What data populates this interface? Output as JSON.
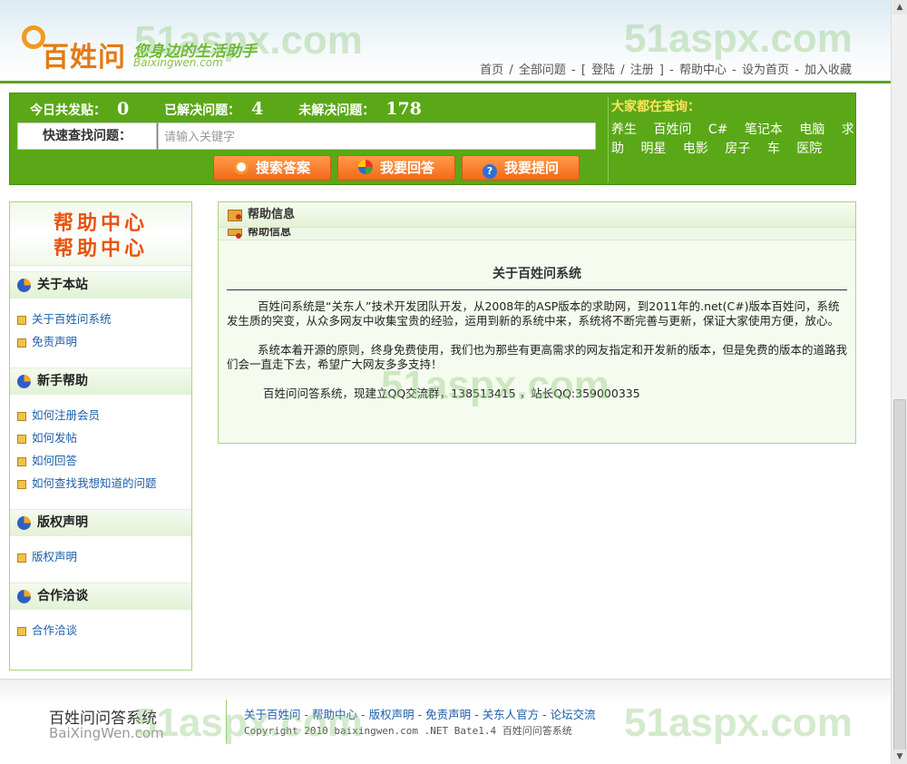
{
  "header": {
    "logo_text": "百姓问",
    "slogan": "您身边的生活助手",
    "slogan_sub": "Baixingwen.com",
    "nav": [
      "首页",
      "/",
      "全部问题",
      "-",
      "[",
      "登陆",
      "/",
      "注册",
      "]",
      "-",
      "帮助中心",
      "-",
      "设为首页",
      "-",
      "加入收藏"
    ]
  },
  "searchbar": {
    "today_label": "今日共发贴：",
    "today_value": "0",
    "solved_label": "已解决问题：",
    "solved_value": "4",
    "unsolved_label": "未解决问题：",
    "unsolved_value": "178",
    "quick_label": "快速查找问题：",
    "input_placeholder": "请输入关键字",
    "btn_search": "搜索答案",
    "btn_answer": "我要回答",
    "btn_ask": "我要提问",
    "hot_title": "大家都在查询：",
    "hot_tags": [
      "养生",
      "百姓问",
      "C#",
      "笔记本",
      "电脑",
      "求助",
      "明星",
      "电影",
      "房子",
      "车",
      "医院"
    ]
  },
  "sidebar": {
    "title": "帮助中心",
    "title_reflection": "帮助中心",
    "sections": [
      {
        "title": "关于本站",
        "items": [
          "关于百姓问系统",
          "免责声明"
        ]
      },
      {
        "title": "新手帮助",
        "items": [
          "如何注册会员",
          "如何发帖",
          "如何回答",
          "如何查找我想知道的问题"
        ]
      },
      {
        "title": "版权声明",
        "items": [
          "版权声明"
        ]
      },
      {
        "title": "合作洽谈",
        "items": [
          "合作洽谈"
        ]
      }
    ]
  },
  "main": {
    "panel_title": "帮助信息",
    "panel_title_reflection": "帮助信息",
    "article_title": "关于百姓问系统",
    "para1": "百姓问系统是“关东人”技术开发团队开发，从2008年的ASP版本的求助网，到2011年的.net(C#)版本百姓问，系统发生质的突变，从众多网友中收集宝贵的经验，运用到新的系统中来，系统将不断完善与更新，保证大家使用方便，放心。",
    "para2": "系统本着开源的原则，终身免费使用，我们也为那些有更高需求的网友指定和开发新的版本，但是免费的版本的道路我们会一直走下去，希望广大网友多多支持！",
    "contact": "百姓问问答系统，现建立QQ交流群，138513415 ，站长QQ:359000335"
  },
  "footer": {
    "logo_text": "百姓问问答系统",
    "logo_sub": "BaiXingWen.com",
    "links": [
      "关于百姓问",
      "帮助中心",
      "版权声明",
      "免责声明",
      "关东人官方",
      "论坛交流"
    ],
    "link_sep": "-",
    "copyright": "Copyright 2010 baixingwen.com  .NET Bate1.4 百姓问问答系统"
  },
  "watermark": "51aspx.com",
  "colors": {
    "brand_green": "#5aa817",
    "accent_orange": "#f16a1a",
    "link_blue": "#1d5fa8"
  }
}
